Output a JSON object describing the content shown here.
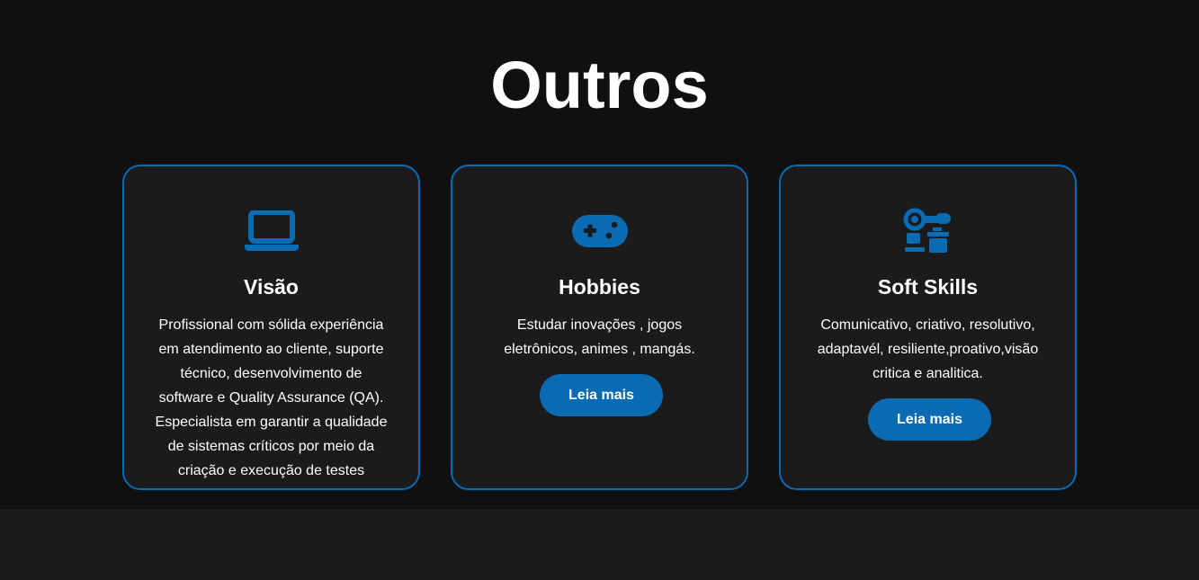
{
  "section": {
    "title": "Outros"
  },
  "colors": {
    "accent": "#0a6bb3",
    "background": "#101010",
    "card_background": "#1b1b1c",
    "text": "#ffffff"
  },
  "cards": [
    {
      "icon": "laptop-icon",
      "title": "Visão",
      "text": "Profissional com sólida experiência em atendimento ao cliente, suporte técnico, desenvolvimento de software e Quality Assurance (QA). Especialista em garantir a qualidade de sistemas críticos por meio da criação e execução de testes funcionais, usabilidade e performance."
    },
    {
      "icon": "gamepad-icon",
      "title": "Hobbies",
      "text": "Estudar inovações , jogos eletrônicos, animes , mangás.",
      "button_label": "Leia mais"
    },
    {
      "icon": "skills-icon",
      "title": "Soft Skills",
      "text": "Comunicativo, criativo, resolutivo, adaptavél, resiliente,proativo,visão critica e analitica.",
      "button_label": "Leia mais"
    }
  ]
}
